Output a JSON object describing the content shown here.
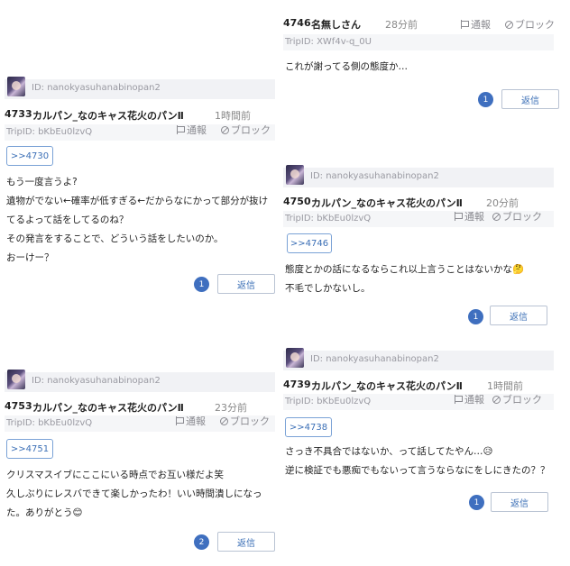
{
  "posts": [
    {
      "id_label": "ID: nanokyasuhanabinopan2",
      "number": "4733",
      "name": "カルパン_なのキャス花火のパンⅡ",
      "time": "1時間前",
      "trip": "TripID: bKbEu0lzvQ",
      "report_label": "通報",
      "block_label": "ブロック",
      "anchor": ">>4730",
      "lines": [
        "もう一度言うよ?",
        "遺物がでない←確率が低すぎる←だからなにかって部分が抜け",
        "てるよって話をしてるのね？",
        "その発言をすることで、どういう話をしたいのか。",
        "おーけー？"
      ],
      "reply_count": "1",
      "reply_label": "返信"
    },
    {
      "number": "4746",
      "name": "名無しさん",
      "time": "28分前",
      "trip": "TripID: XWf4v-q_0U",
      "report_label": "通報",
      "block_label": "ブロック",
      "lines": [
        "これが謝ってる側の態度か…"
      ],
      "reply_count": "1",
      "reply_label": "返信"
    },
    {
      "id_label": "ID: nanokyasuhanabinopan2",
      "number": "4750",
      "name": "カルパン_なのキャス花火のパンⅡ",
      "time": "20分前",
      "trip": "TripID: bKbEu0lzvQ",
      "report_label": "通報",
      "block_label": "ブロック",
      "anchor": ">>4746",
      "lines": [
        "態度とかの話になるならこれ以上言うことはないかな🤔",
        "不毛でしかないし。"
      ],
      "reply_count": "1",
      "reply_label": "返信"
    },
    {
      "id_label": "ID: nanokyasuhanabinopan2",
      "number": "4753",
      "name": "カルパン_なのキャス花火のパンⅡ",
      "time": "23分前",
      "trip": "TripID: bKbEu0lzvQ",
      "report_label": "通報",
      "block_label": "ブロック",
      "anchor": ">>4751",
      "lines": [
        "クリスマスイブにここにいる時点でお互い様だよ笑",
        "久しぶりにレスバできて楽しかったわ！いい時間潰しになっ",
        "た。ありがとう😊"
      ],
      "reply_count": "2",
      "reply_label": "返信"
    },
    {
      "id_label": "ID: nanokyasuhanabinopan2",
      "number": "4739",
      "name": "カルパン_なのキャス花火のパンⅡ",
      "time": "1時間前",
      "trip": "TripID: bKbEu0lzvQ",
      "report_label": "通報",
      "block_label": "ブロック",
      "anchor": ">>4738",
      "lines": [
        "さっき不具合ではないか、って話してたやん…😥",
        "逆に検証でも悪痴でもないって言うならなにをしにきたの？？"
      ],
      "reply_count": "1",
      "reply_label": "返信"
    }
  ]
}
